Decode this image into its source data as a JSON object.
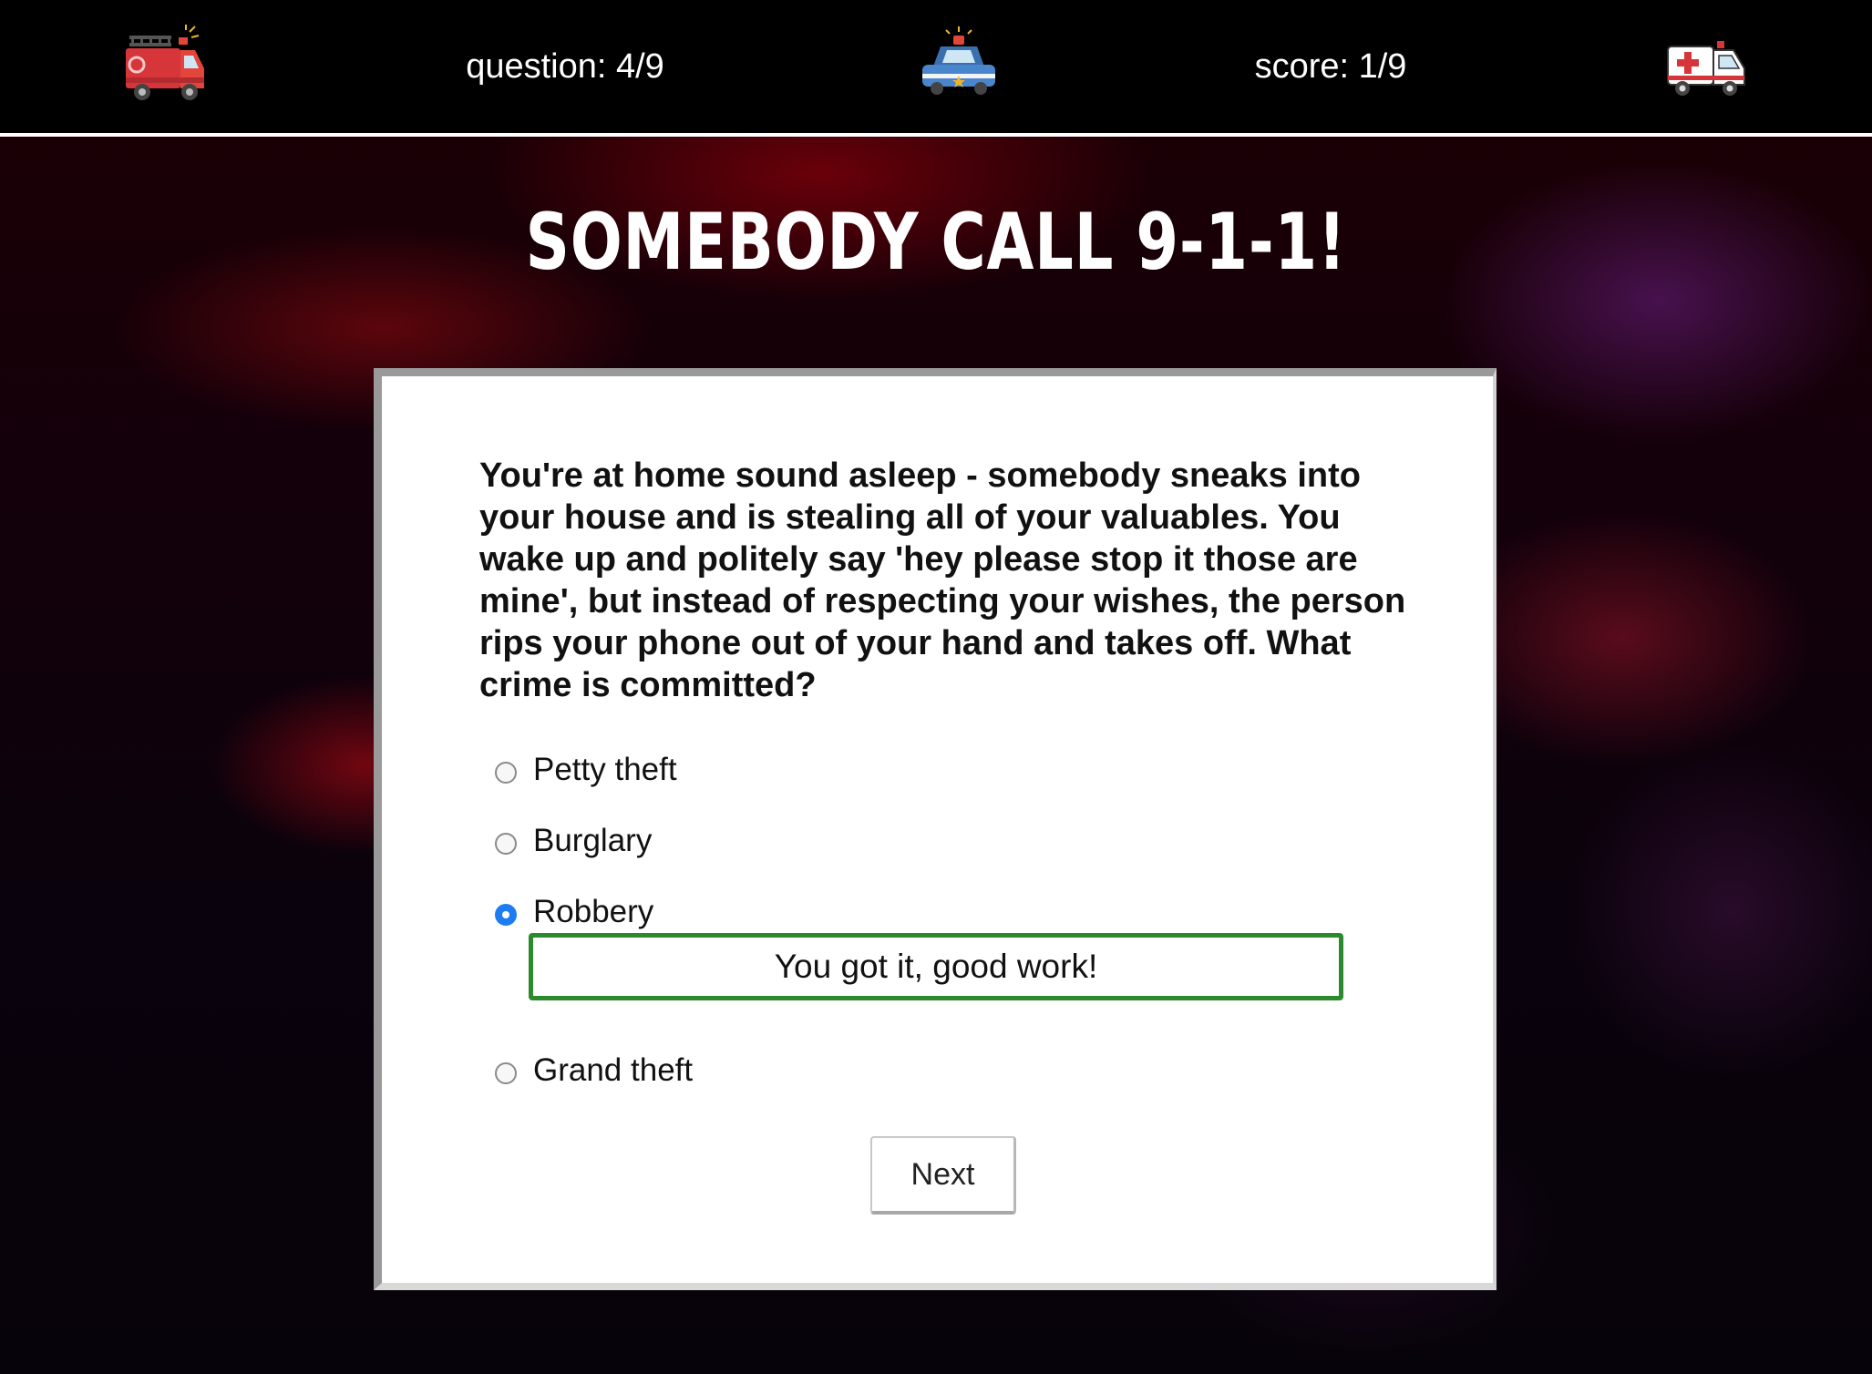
{
  "header": {
    "left_icon": "fire-truck-icon",
    "question_counter": "question: 4/9",
    "center_icon": "police-car-icon",
    "score": "score: 1/9",
    "right_icon": "ambulance-icon"
  },
  "title": "SOMEBODY CALL 9-1-1!",
  "quiz": {
    "question": "You're at home sound asleep - somebody sneaks into your house and is stealing all of your valuables. You wake up and politely say 'hey please stop it those are mine', but instead of respecting your wishes, the person rips your phone out of your hand and takes off. What crime is committed?",
    "options": [
      {
        "label": "Petty theft",
        "selected": false
      },
      {
        "label": "Burglary",
        "selected": false
      },
      {
        "label": "Robbery",
        "selected": true
      },
      {
        "label": "Grand theft",
        "selected": false
      }
    ],
    "feedback": "You got it, good work!",
    "next_label": "Next"
  },
  "colors": {
    "header_bg": "#000000",
    "feedback_border": "#2c8a2c",
    "radio_selected": "#1e7cf2"
  }
}
